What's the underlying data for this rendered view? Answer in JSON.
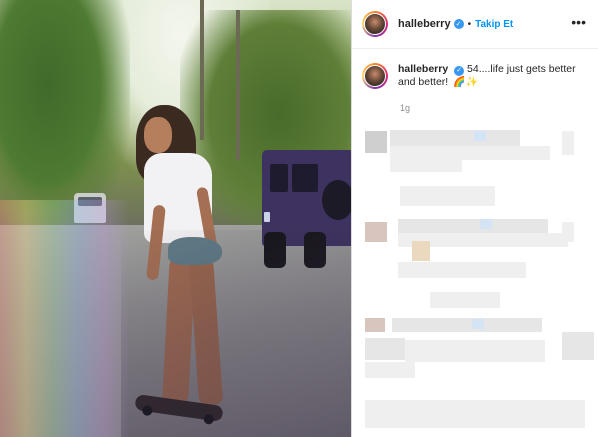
{
  "post": {
    "username": "halleberry",
    "verified_glyph": "✓",
    "separator": "•",
    "follow_label": "Takip Et",
    "more_icon": "•••",
    "caption_username": "halleberry",
    "caption_text": "54....life just gets better and better!",
    "caption_emojis": "🌈✨",
    "time_ago": "1g"
  },
  "icons": {
    "verified": "verified-badge-icon",
    "more": "more-options-icon"
  },
  "colors": {
    "follow_blue": "#0095f6",
    "verified_blue": "#3897f0",
    "muted_gray": "#8e8e8e"
  }
}
